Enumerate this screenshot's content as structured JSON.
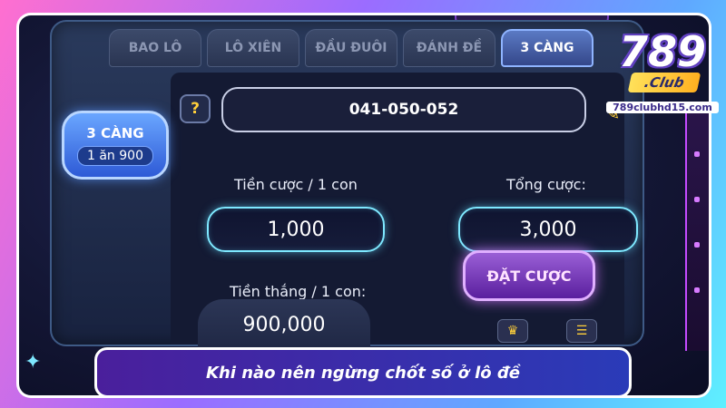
{
  "tabs": [
    {
      "label": "BAO LÔ",
      "active": false
    },
    {
      "label": "LÔ XIÊN",
      "active": false
    },
    {
      "label": "ĐẦU ĐUÔI",
      "active": false
    },
    {
      "label": "ĐÁNH ĐỀ",
      "active": false
    },
    {
      "label": "3 CÀNG",
      "active": true
    }
  ],
  "badge": {
    "title": "3 CÀNG",
    "odds": "1 ăn 900"
  },
  "help": {
    "icon": "question-icon",
    "label": "?"
  },
  "numbers": {
    "value": "041-050-052",
    "edit_icon": "pencil-icon"
  },
  "stake": {
    "label": "Tiền cược / 1 con",
    "value": "1,000"
  },
  "total": {
    "label": "Tổng cược:",
    "value": "3,000"
  },
  "win": {
    "label": "Tiền thắng / 1 con:",
    "value": "900,000"
  },
  "bet_button": {
    "label": "ĐẶT CƯỢC"
  },
  "logo": {
    "number": "789",
    "club": ".Club",
    "domain": "789clubhd15.com"
  },
  "caption": "Khi nào nên ngừng chốt số ở lô đề",
  "colors": {
    "accent_cyan": "#7ee8ff",
    "bet_purple": "#9a5fd6",
    "active_tab": "#5b7ac4"
  }
}
